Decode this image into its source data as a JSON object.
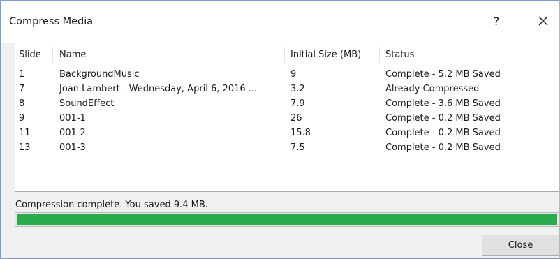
{
  "window": {
    "title": "Compress Media",
    "help_glyph": "?"
  },
  "table": {
    "headers": {
      "slide": "Slide",
      "name": "Name",
      "size": "Initial Size (MB)",
      "status": "Status"
    },
    "rows": [
      {
        "slide": "1",
        "name": "BackgroundMusic",
        "size": "9",
        "status": "Complete - 5.2 MB Saved"
      },
      {
        "slide": "7",
        "name": "Joan Lambert - Wednesday, April 6, 2016 ...",
        "size": "3.2",
        "status": "Already Compressed"
      },
      {
        "slide": "8",
        "name": "SoundEffect",
        "size": "7.9",
        "status": "Complete - 3.6 MB Saved"
      },
      {
        "slide": "9",
        "name": "001-1",
        "size": "26",
        "status": "Complete - 0.2 MB Saved"
      },
      {
        "slide": "11",
        "name": "001-2",
        "size": "15.8",
        "status": "Complete - 0.2 MB Saved"
      },
      {
        "slide": "13",
        "name": "001-3",
        "size": "7.5",
        "status": "Complete - 0.2 MB Saved"
      }
    ]
  },
  "status_message": "Compression complete. You saved 9.4 MB.",
  "progress": {
    "percent": 100,
    "color": "#2aac4b"
  },
  "buttons": {
    "close_label": "Close"
  },
  "icons": {
    "help": "help-icon",
    "close": "close-icon"
  }
}
